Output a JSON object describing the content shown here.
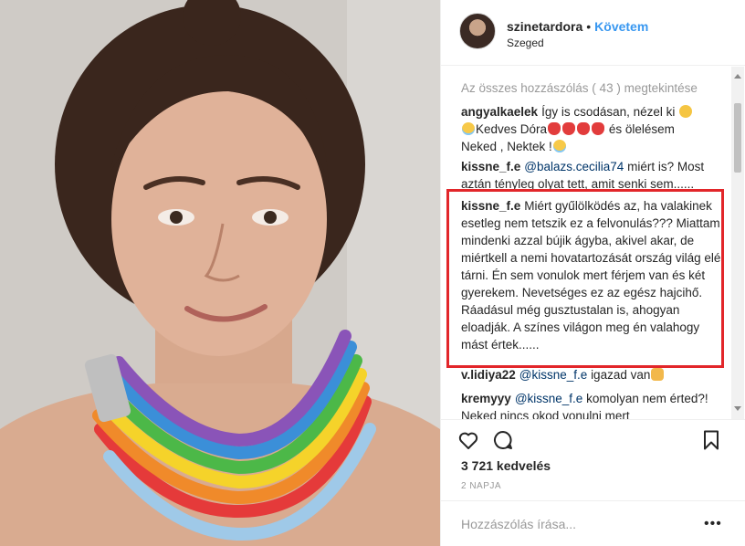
{
  "post": {
    "username": "szinetardora",
    "separator": "•",
    "follow_label": "Követem",
    "location": "Szeged"
  },
  "comments": {
    "view_all": "Az összes hozzászólás ( 43 ) megtekintése",
    "items": [
      {
        "user": "angyalkaelek",
        "text_1": "Így is csodásan, nézel ki",
        "text_2": "Kedves Dóra",
        "text_3": "és ölelésem",
        "text_4": "Neked , Nektek !"
      },
      {
        "user": "kissne_f.e",
        "mention": "@balazs.cecilia74",
        "text": "miért is? Most aztán tényleg olyat tett, amit senki sem......"
      },
      {
        "user": "kissne_f.e",
        "text": "Miért gyűlölködés az, ha valakinek esetleg nem tetszik ez a felvonulás??? Miattam mindenki azzal bújik ágyba, akivel akar, de miértkell a nemi hovatartozását ország világ elé tárni. Én sem vonulok mert férjem van és két gyerekem. Nevetséges ez az egész hajcihő. Ráadásul még gusztustalan is, ahogyan eloadják. A színes világon meg én valahogy mást értek......"
      },
      {
        "user": "v.lidiya22",
        "mention": "@kissne_f.e",
        "text": "igazad van"
      },
      {
        "user": "kremyyy",
        "mention": "@kissne_f.e",
        "text": "komolyan nem érted?! Neked nincs okod vonulni mert"
      }
    ]
  },
  "icons": {
    "heart": "heart-icon",
    "comment": "comment-icon",
    "bookmark": "bookmark-icon",
    "more": "more-options-icon"
  },
  "stats": {
    "likes": "3 721 kedvelés",
    "time": "2 NAPJA"
  },
  "comment_input": {
    "placeholder": "Hozzászólás írása...",
    "more_label": "•••"
  },
  "colors": {
    "link": "#003569",
    "follow": "#3897f0",
    "highlight": "#e2262a",
    "muted": "#999999"
  }
}
